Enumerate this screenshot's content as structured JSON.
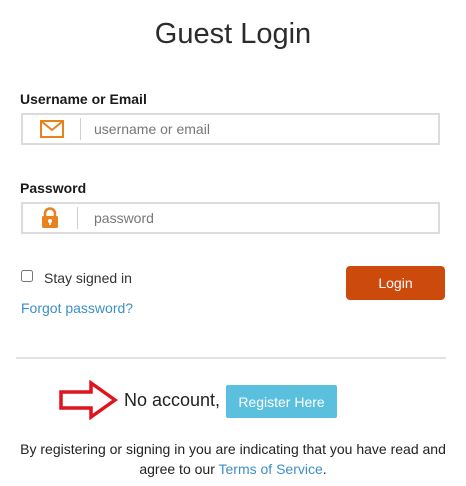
{
  "page": {
    "title": "Guest Login"
  },
  "username": {
    "label": "Username or Email",
    "placeholder": "username or email",
    "value": "",
    "icon": "envelope-icon"
  },
  "password": {
    "label": "Password",
    "placeholder": "password",
    "value": "",
    "icon": "lock-icon"
  },
  "stay_signed_in": {
    "label": "Stay signed in",
    "checked": false
  },
  "login_button": {
    "label": "Login"
  },
  "forgot_link": {
    "label": "Forgot password?"
  },
  "register": {
    "prompt": "No account,",
    "button_label": "Register Here",
    "arrow_icon": "arrow-right-icon"
  },
  "footer": {
    "line1": "By registering or signing in you are indicating that you have read and",
    "line2_prefix": "agree to our ",
    "terms_link": "Terms of Service",
    "line2_suffix": "."
  },
  "colors": {
    "accent_orange": "#cc4a0c",
    "icon_orange": "#e8821e",
    "register_blue": "#5bc0de",
    "link_blue": "#3c8fc7",
    "arrow_red": "#e0141e"
  }
}
